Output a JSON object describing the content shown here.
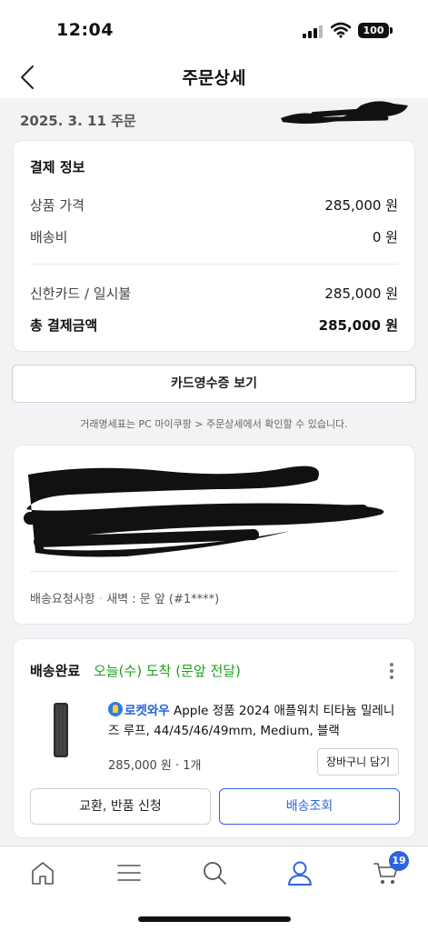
{
  "status_bar": {
    "time": "12:04",
    "battery": "100"
  },
  "navbar": {
    "title": "주문상세"
  },
  "order": {
    "date_label": "2025. 3. 11 주문"
  },
  "payment": {
    "title": "결제 정보",
    "product_price_label": "상품 가격",
    "product_price_value": "285,000 원",
    "shipping_label": "배송비",
    "shipping_value": "0 원",
    "card_label": "신한카드 / 일시불",
    "card_value": "285,000 원",
    "total_label": "총 결제금액",
    "total_value": "285,000 원"
  },
  "receipt": {
    "button_label": "카드영수증 보기",
    "note": "거래명세표는 PC 마이쿠팡 > 주문상세에서 확인할 수 있습니다."
  },
  "address": {
    "request_label": "배송요청사항",
    "request_separator": "·",
    "request_value": "새벽 : 문 앞 (#1****)"
  },
  "delivery": {
    "status": "배송완료",
    "eta": "오늘(수) 도착 (문앞 전달)",
    "rocket_label": "로켓와우",
    "product_name": "Apple 정품 2024 애플워치 티타늄 밀레니즈 루프, 44/45/46/49mm, Medium, 블랙",
    "price_qty": "285,000 원 · 1개",
    "cart_button": "장바구니 담기",
    "exchange_button": "교환, 반품 신청",
    "tracking_button": "배송조회"
  },
  "tabbar": {
    "cart_count": "19",
    "tabs": [
      "home-icon",
      "menu-icon",
      "search-icon",
      "user-icon",
      "cart-icon"
    ],
    "active_color": "#2f63e0"
  },
  "colors": {
    "accent": "#2f63e0",
    "eta_green": "#1aa11a",
    "rocket_blue": "#1f63d8"
  }
}
